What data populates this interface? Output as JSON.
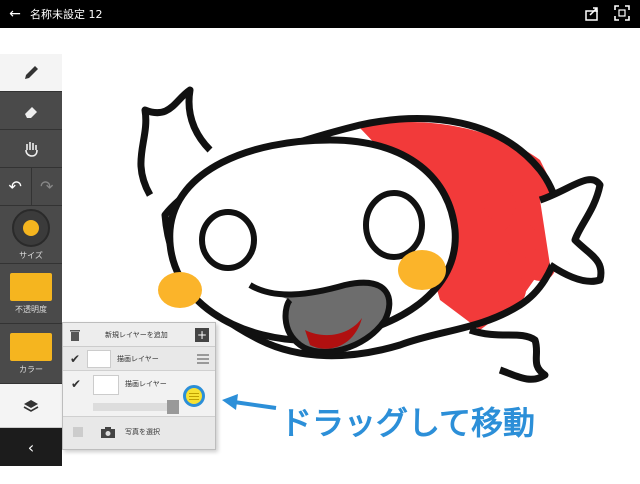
{
  "topbar": {
    "back_icon": "arrow-left-icon",
    "title": "名称未設定 12",
    "share_icon": "share-icon",
    "fullscreen_icon": "fullscreen-icon"
  },
  "toolbar": {
    "tools": [
      "pencil-icon",
      "eraser-icon",
      "hand-icon"
    ],
    "undo_icon": "undo-icon",
    "redo_icon": "redo-icon",
    "size_label": "サイズ",
    "opacity_label": "不透明度",
    "color_label": "カラー",
    "brush_color": "#f5b51f",
    "layers_icon": "layers-icon",
    "collapse_icon": "chevron-left-icon"
  },
  "layers": {
    "add_label": "新規レイヤーを追加",
    "items": [
      {
        "name": "描画レイヤー",
        "checked": true
      },
      {
        "name": "描画レイヤー",
        "checked": true
      }
    ],
    "photo_label": "写真を選択"
  },
  "callout": {
    "text": "ドラッグして移動",
    "color": "#2c8fd8"
  }
}
